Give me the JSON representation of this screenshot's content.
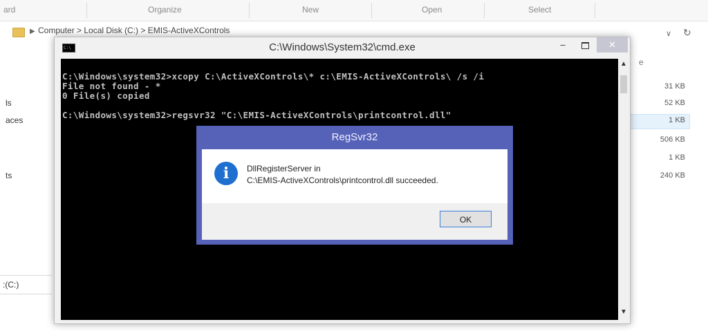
{
  "explorer": {
    "ribbon": [
      "ard",
      "Organize",
      "New",
      "Open",
      "Select"
    ],
    "address_path": "Computer  >  Local Disk (C:)  >  EMIS-ActiveXControls",
    "column_header_fragment": "e",
    "nav_items": [
      "ls",
      "aces",
      "ts"
    ],
    "drive_label": ":(C:)",
    "sizes": [
      "31 KB",
      "52 KB",
      "1 KB",
      "506 KB",
      "1 KB",
      "240 KB"
    ]
  },
  "cmd": {
    "title": "C:\\Windows\\System32\\cmd.exe",
    "icon_text": "C:\\",
    "minimize": "–",
    "close": "✕",
    "lines": [
      "C:\\Windows\\system32>xcopy C:\\ActiveXControls\\* c:\\EMIS-ActiveXControls\\ /s /i",
      "File not found - *",
      "0 File(s) copied",
      "",
      "C:\\Windows\\system32>regsvr32 \"C:\\EMIS-ActiveXControls\\printcontrol.dll\""
    ],
    "scroll_up": "▲",
    "scroll_down": "▼"
  },
  "dialog": {
    "title": "RegSvr32",
    "icon": "i",
    "message_line1": "DllRegisterServer in",
    "message_line2": "C:\\EMIS-ActiveXControls\\printcontrol.dll succeeded.",
    "ok_label": "OK"
  }
}
